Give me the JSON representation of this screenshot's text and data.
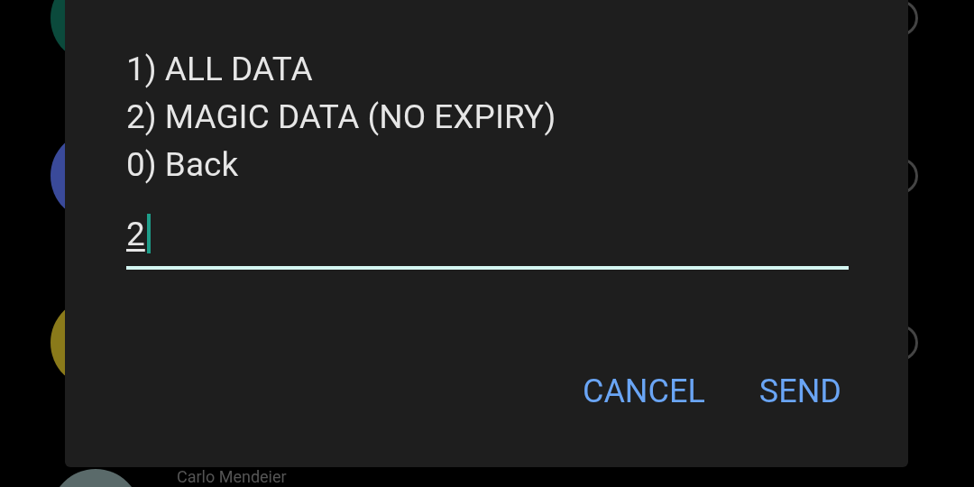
{
  "background_list": {
    "items": [
      {
        "color": "#0b4a3c"
      },
      {
        "color": "#3a4a9a"
      },
      {
        "color": "#8a7a1a"
      },
      {
        "color": "#5a6a6a",
        "name": "Carlo Mendeier"
      }
    ]
  },
  "dialog": {
    "message_lines": [
      "1) ALL DATA",
      "2) MAGIC DATA (NO EXPIRY)",
      "0) Back"
    ],
    "input": {
      "value": "2"
    },
    "buttons": [
      "CANCEL",
      "SEND"
    ]
  }
}
